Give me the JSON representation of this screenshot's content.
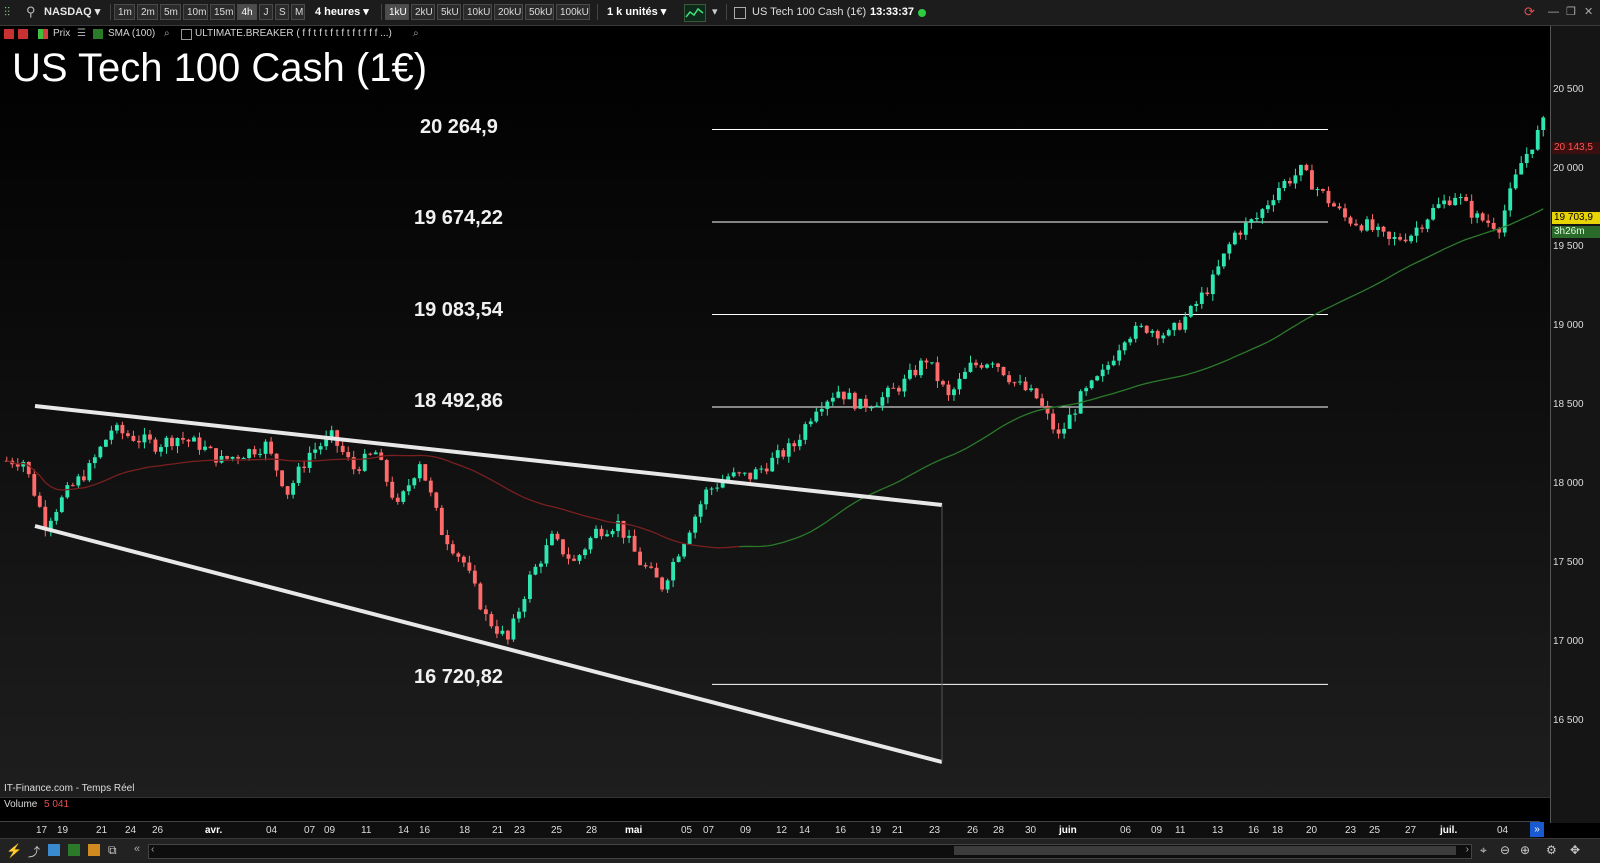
{
  "toolbar": {
    "instrument": "NASDAQ",
    "timeframes": [
      "1m",
      "2m",
      "5m",
      "10m",
      "15m",
      "4h",
      "J",
      "S",
      "M"
    ],
    "active_timeframe": "4h",
    "period_select": "4 heures",
    "units": [
      "1kU",
      "2kU",
      "5kU",
      "10kU",
      "20kU",
      "50kU",
      "100kU"
    ],
    "active_unit": "1kU",
    "units_select": "1 k unités",
    "window_title": "US Tech 100 Cash (1€)",
    "clock": "13:33:37",
    "status_color": "#2ecc40"
  },
  "indicators": {
    "price_label": "Prix",
    "sma_label": "SMA (100)",
    "breaker_label": "ULTIMATE.BREAKER ( f f t f t f t f t f t f f f ...)"
  },
  "chart": {
    "title": "US Tech 100 Cash (1€)",
    "levels": [
      "20 264,9",
      "19 674,22",
      "19 083,54",
      "18 492,86",
      "16 720,82"
    ],
    "price_ticks": [
      "20 500",
      "20 000",
      "19 500",
      "19 000",
      "18 500",
      "18 000",
      "17 500",
      "17 000",
      "16 500"
    ],
    "last_price": "20 143,5",
    "current_price": "19 703,9",
    "countdown": "3h26m",
    "source": "IT-Finance.com - Temps Réel",
    "volume_label": "Volume",
    "volume_value": "5 041",
    "colors": {
      "up": "#2ee6b0",
      "down": "#ff6b6b",
      "sma": "#2b7a2b",
      "sma_down": "#7a1f1f",
      "levels": "#ffffff"
    }
  },
  "chart_data": {
    "type": "candlestick",
    "title": "US Tech 100 Cash (1€)",
    "y_ticks": [
      20500,
      20000,
      19500,
      19000,
      18500,
      18000,
      17500,
      17000,
      16500
    ],
    "ylim": [
      16000,
      20900
    ],
    "horizontal_levels": [
      20264.9,
      19674.22,
      19083.54,
      18492.86,
      16720.82
    ],
    "last_price": 20143.5,
    "current_price": 19703.9,
    "x_ticks": [
      "17",
      "19",
      "21",
      "24",
      "26",
      "avr.",
      "04",
      "07",
      "09",
      "11",
      "14",
      "16",
      "18",
      "21",
      "23",
      "25",
      "28",
      "mai",
      "05",
      "07",
      "09",
      "12",
      "14",
      "16",
      "19",
      "21",
      "23",
      "26",
      "28",
      "30",
      "juin",
      "06",
      "09",
      "11",
      "13",
      "16",
      "18",
      "20",
      "23",
      "25",
      "27",
      "juil.",
      "04"
    ],
    "approx_closes": [
      18150,
      17750,
      17950,
      18100,
      18350,
      18300,
      18250,
      18300,
      18250,
      18150,
      18200,
      18250,
      17950,
      18200,
      18300,
      18100,
      18200,
      17850,
      18150,
      17700,
      17500,
      17150,
      17000,
      17400,
      17650,
      17500,
      17700,
      17750,
      17500,
      17350,
      17650,
      17950,
      18050,
      18050,
      18150,
      18250,
      18500,
      18600,
      18500,
      18550,
      18650,
      18800,
      18550,
      18750,
      18800,
      18650,
      18550,
      18300,
      18550,
      18700,
      18950,
      19000,
      18950,
      19100,
      19300,
      19600,
      19700,
      19900,
      20000,
      19850,
      19700,
      19650,
      19550,
      19600,
      19750,
      19850,
      19700,
      19650,
      20050,
      20300
    ]
  },
  "time_axis": {
    "labels": [
      {
        "text": "17",
        "month": false
      },
      {
        "text": "19",
        "month": false
      },
      {
        "text": "21",
        "month": false
      },
      {
        "text": "24",
        "month": false
      },
      {
        "text": "26",
        "month": false
      },
      {
        "text": "avr.",
        "month": true
      },
      {
        "text": "04",
        "month": false
      },
      {
        "text": "07",
        "month": false
      },
      {
        "text": "09",
        "month": false
      },
      {
        "text": "11",
        "month": false
      },
      {
        "text": "14",
        "month": false
      },
      {
        "text": "16",
        "month": false
      },
      {
        "text": "18",
        "month": false
      },
      {
        "text": "21",
        "month": false
      },
      {
        "text": "23",
        "month": false
      },
      {
        "text": "25",
        "month": false
      },
      {
        "text": "28",
        "month": false
      },
      {
        "text": "mai",
        "month": true
      },
      {
        "text": "05",
        "month": false
      },
      {
        "text": "07",
        "month": false
      },
      {
        "text": "09",
        "month": false
      },
      {
        "text": "12",
        "month": false
      },
      {
        "text": "14",
        "month": false
      },
      {
        "text": "16",
        "month": false
      },
      {
        "text": "19",
        "month": false
      },
      {
        "text": "21",
        "month": false
      },
      {
        "text": "23",
        "month": false
      },
      {
        "text": "26",
        "month": false
      },
      {
        "text": "28",
        "month": false
      },
      {
        "text": "30",
        "month": false
      },
      {
        "text": "juin",
        "month": true
      },
      {
        "text": "06",
        "month": false
      },
      {
        "text": "09",
        "month": false
      },
      {
        "text": "11",
        "month": false
      },
      {
        "text": "13",
        "month": false
      },
      {
        "text": "16",
        "month": false
      },
      {
        "text": "18",
        "month": false
      },
      {
        "text": "20",
        "month": false
      },
      {
        "text": "23",
        "month": false
      },
      {
        "text": "25",
        "month": false
      },
      {
        "text": "27",
        "month": false
      },
      {
        "text": "juil.",
        "month": true
      },
      {
        "text": "04",
        "month": false
      }
    ]
  }
}
